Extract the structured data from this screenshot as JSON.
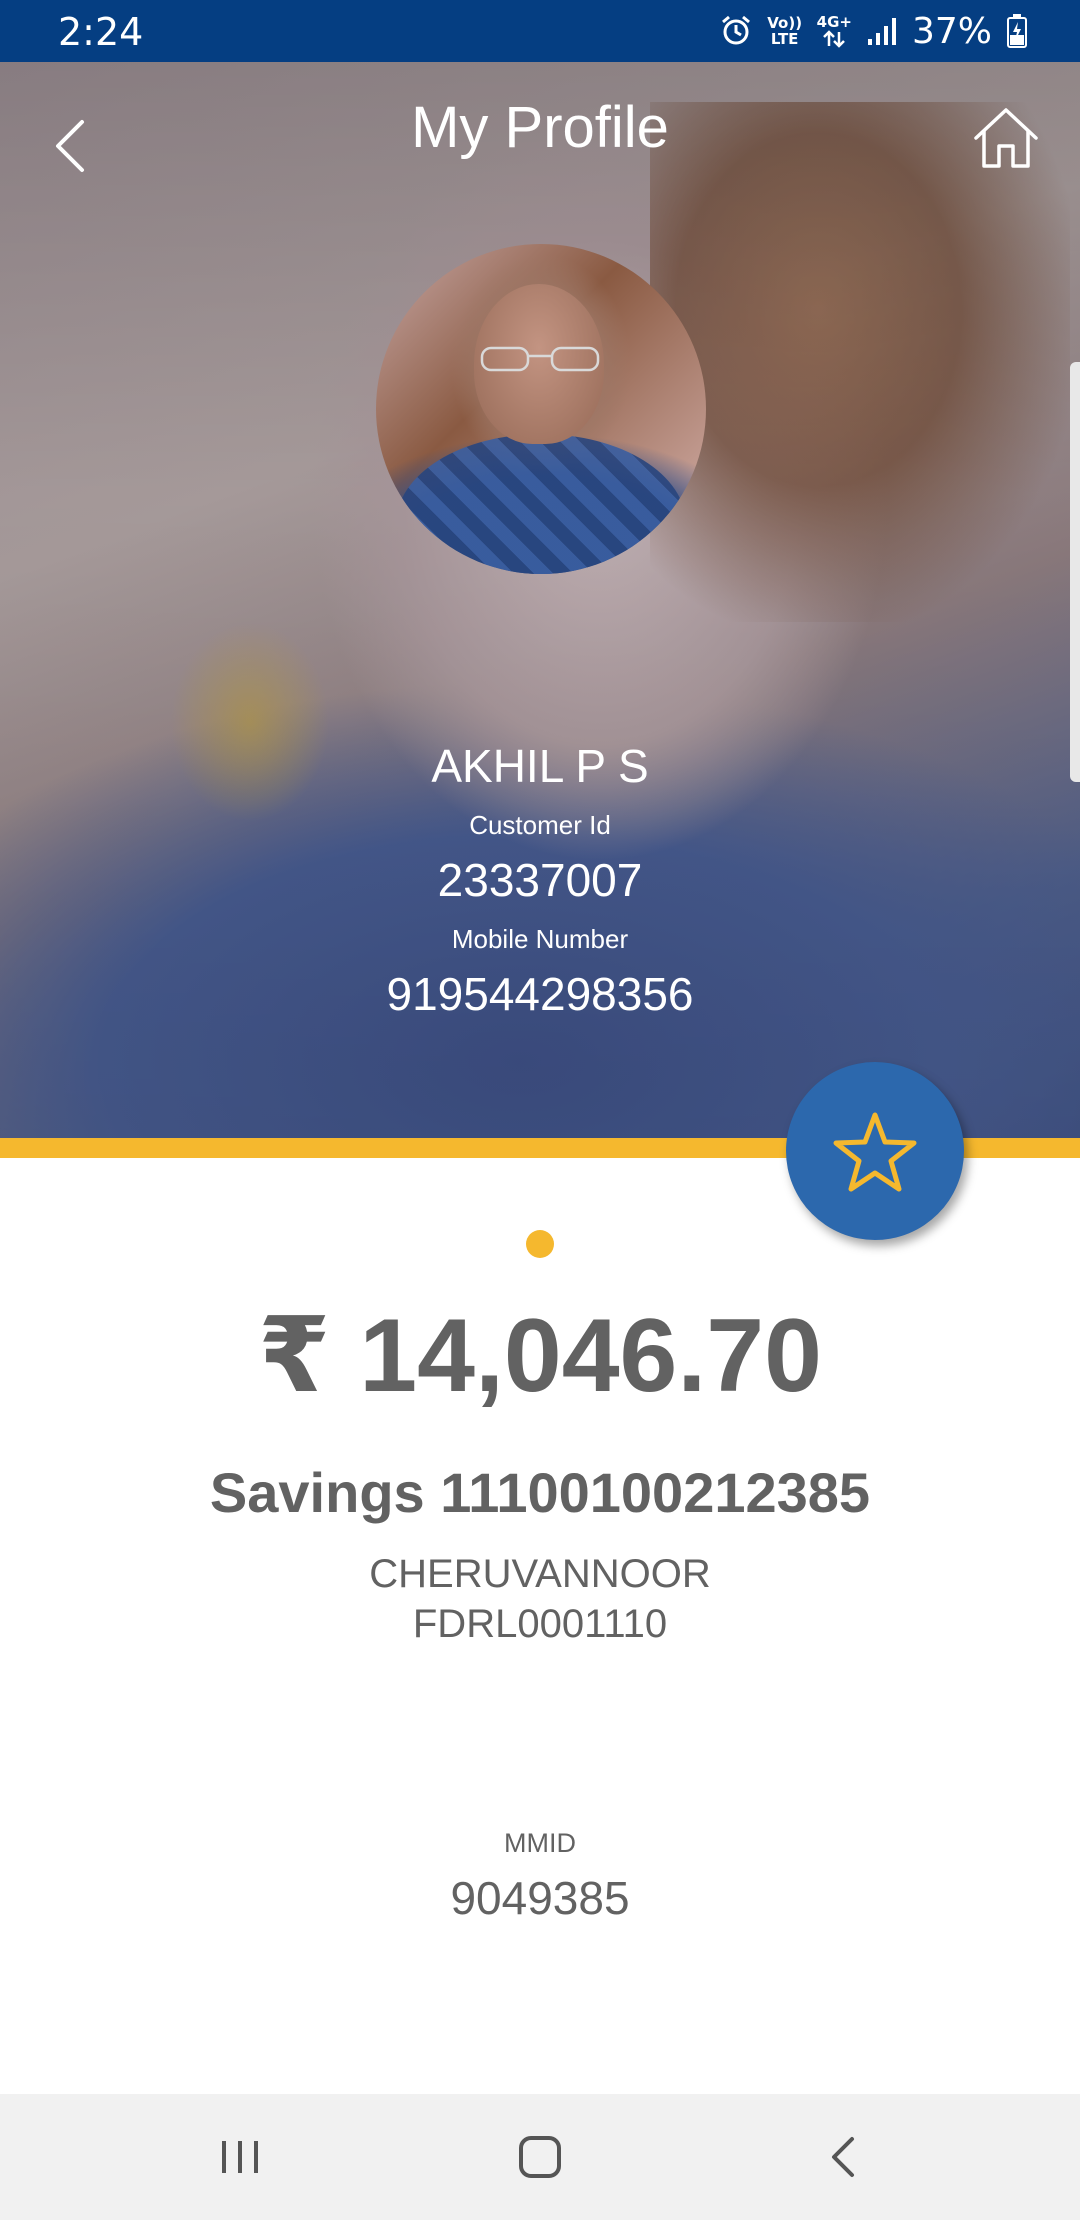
{
  "status_bar": {
    "time": "2:24",
    "volte": "Vo)) LTE",
    "network": "4G+",
    "battery": "37%",
    "icons": [
      "alarm-icon",
      "volte-icon",
      "data-arrows-icon",
      "signal-icon",
      "battery-charging-icon"
    ]
  },
  "header": {
    "title": "My Profile",
    "back_icon": "chevron-left-icon",
    "home_icon": "home-icon"
  },
  "profile": {
    "name": "AKHIL P S",
    "customer_id_label": "Customer Id",
    "customer_id": "23337007",
    "mobile_label": "Mobile Number",
    "mobile": "919544298356"
  },
  "favorite_button": {
    "icon": "star-icon"
  },
  "account": {
    "balance": "₹ 14,046.70",
    "account": "Savings 11100100212385",
    "branch": "CHERUVANNOOR",
    "ifsc": "FDRL0001110",
    "mmid_label": "MMID",
    "mmid": "9049385"
  },
  "nav": {
    "icons": [
      "recent-apps-icon",
      "home-icon",
      "back-icon"
    ]
  },
  "colors": {
    "status_bar": "#053e82",
    "accent": "#f5b82e",
    "fab": "#2c68ad",
    "text_gray": "#626262",
    "nav_bar": "#f1f1f1"
  }
}
